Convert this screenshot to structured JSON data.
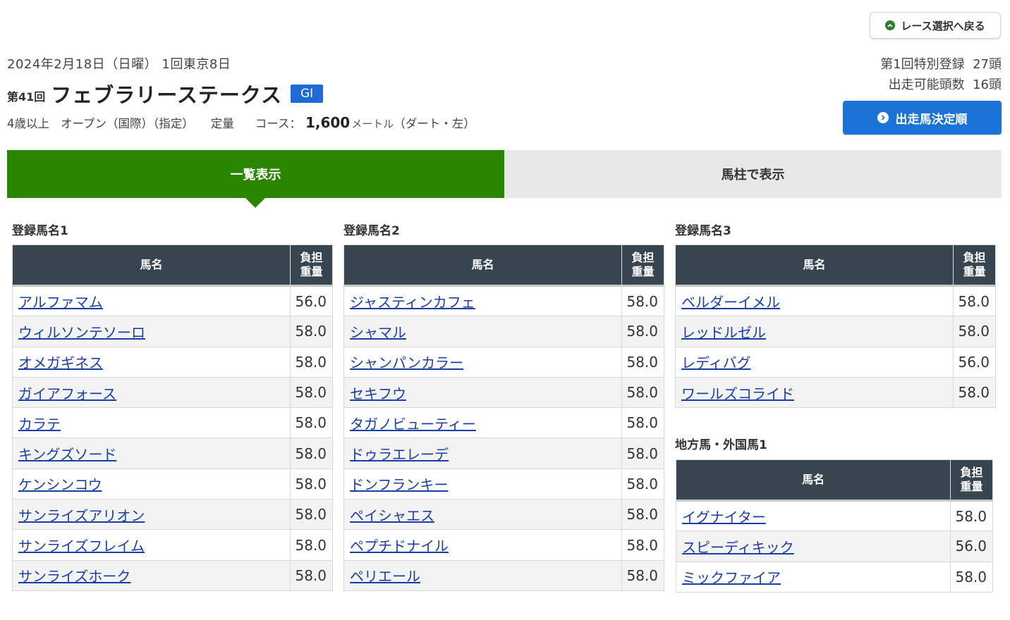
{
  "header": {
    "back_button_label": "レース選択へ戻る",
    "date": "2024年2月18日（日曜） 1回東京8日",
    "race_number": "第41回",
    "race_name": "フェブラリーステークス",
    "grade": "GI",
    "conditions": {
      "age": "4歳以上",
      "class": "オープン（国際）（指定）",
      "weight_rule": "定量",
      "course_label": "コース：",
      "distance": "1,600",
      "unit": "メートル",
      "surface": "（ダート・左）"
    },
    "special_registration": "第1回特別登録  27頭",
    "eligible_count": "出走可能頭数  16頭",
    "decide_button_label": "出走馬決定順"
  },
  "tabs": [
    {
      "label": "一覧表示",
      "active": true
    },
    {
      "label": "馬柱で表示",
      "active": false
    }
  ],
  "colors": {
    "active_tab": "#2a8500",
    "table_header": "#36454f",
    "grade_badge": "#1f6ad6",
    "link": "#1a3ea8"
  },
  "table_headers": {
    "name": "馬名",
    "weight_line1": "負担",
    "weight_line2": "重量"
  },
  "groups": [
    {
      "title": "登録馬名1",
      "horses": [
        {
          "name": "アルファマム",
          "weight": "56.0"
        },
        {
          "name": "ウィルソンテソーロ",
          "weight": "58.0"
        },
        {
          "name": "オメガギネス",
          "weight": "58.0"
        },
        {
          "name": "ガイアフォース",
          "weight": "58.0"
        },
        {
          "name": "カラテ",
          "weight": "58.0"
        },
        {
          "name": "キングズソード",
          "weight": "58.0"
        },
        {
          "name": "ケンシンコウ",
          "weight": "58.0"
        },
        {
          "name": "サンライズアリオン",
          "weight": "58.0"
        },
        {
          "name": "サンライズフレイム",
          "weight": "58.0"
        },
        {
          "name": "サンライズホーク",
          "weight": "58.0"
        }
      ]
    },
    {
      "title": "登録馬名2",
      "horses": [
        {
          "name": "ジャスティンカフェ",
          "weight": "58.0"
        },
        {
          "name": "シャマル",
          "weight": "58.0"
        },
        {
          "name": "シャンパンカラー",
          "weight": "58.0"
        },
        {
          "name": "セキフウ",
          "weight": "58.0"
        },
        {
          "name": "タガノビューティー",
          "weight": "58.0"
        },
        {
          "name": "ドゥラエレーデ",
          "weight": "58.0"
        },
        {
          "name": "ドンフランキー",
          "weight": "58.0"
        },
        {
          "name": "ペイシャエス",
          "weight": "58.0"
        },
        {
          "name": "ペプチドナイル",
          "weight": "58.0"
        },
        {
          "name": "ペリエール",
          "weight": "58.0"
        }
      ]
    },
    {
      "title": "登録馬名3",
      "horses": [
        {
          "name": "ベルダーイメル",
          "weight": "58.0"
        },
        {
          "name": "レッドルゼル",
          "weight": "58.0"
        },
        {
          "name": "レディバグ",
          "weight": "56.0"
        },
        {
          "name": "ワールズコライド",
          "weight": "58.0"
        }
      ]
    },
    {
      "title": "地方馬・外国馬1",
      "horses": [
        {
          "name": "イグナイター",
          "weight": "58.0"
        },
        {
          "name": "スピーディキック",
          "weight": "56.0"
        },
        {
          "name": "ミックファイア",
          "weight": "58.0"
        }
      ]
    }
  ]
}
